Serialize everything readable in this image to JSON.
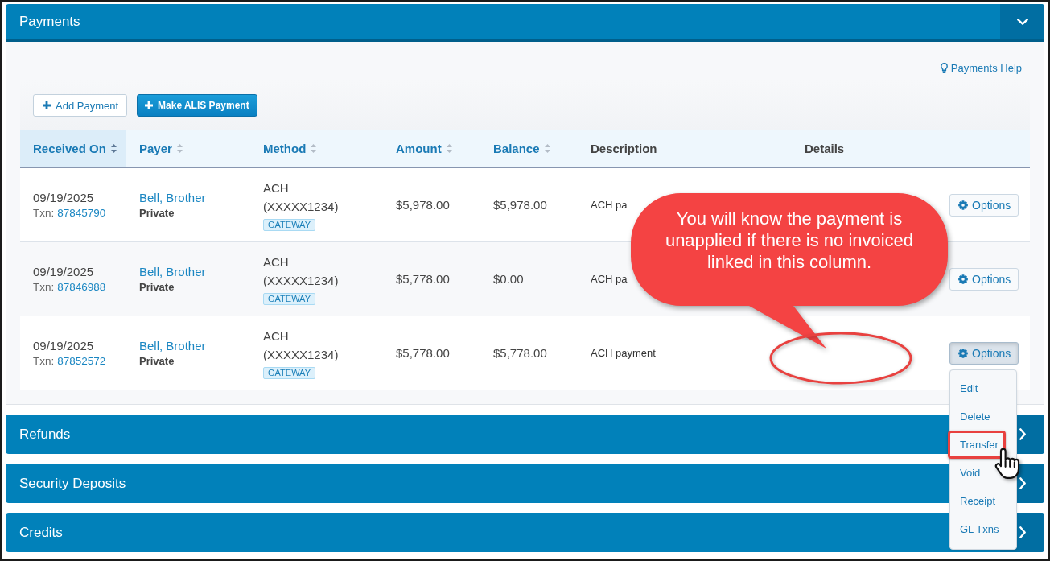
{
  "sections": [
    {
      "title": "Payments",
      "expanded": true,
      "help_link": "Payments Help",
      "toolbar": [
        {
          "label": "Add Payment",
          "kind": "secondary"
        },
        {
          "label": "Make ALIS Payment",
          "kind": "primary"
        }
      ],
      "table": {
        "columns": [
          {
            "label": "Received On",
            "sortable": true,
            "sorted": true
          },
          {
            "label": "Payer",
            "sortable": true,
            "sorted": false
          },
          {
            "label": "Method",
            "sortable": true,
            "sorted": false
          },
          {
            "label": "Amount",
            "sortable": true,
            "sorted": false
          },
          {
            "label": "Balance",
            "sortable": true,
            "sorted": false
          },
          {
            "label": "Description",
            "sortable": false,
            "sorted": false
          },
          {
            "label": "Details",
            "sortable": false,
            "sorted": false
          }
        ],
        "rows": [
          {
            "received_on": "09/19/2025",
            "txn_label": "Txn:",
            "txn": "87845790",
            "payer": "Bell, Brother",
            "payer_type": "Private",
            "method": "ACH",
            "account": "(XXXXX1234)",
            "badge": "GATEWAY",
            "amount": "$5,978.00",
            "balance": "$5,978.00",
            "description": "ACH pa",
            "options": "Options",
            "menu_open": false
          },
          {
            "received_on": "09/19/2025",
            "txn_label": "Txn:",
            "txn": "87846988",
            "payer": "Bell, Brother",
            "payer_type": "Private",
            "method": "ACH",
            "account": "(XXXXX1234)",
            "badge": "GATEWAY",
            "amount": "$5,778.00",
            "balance": "$0.00",
            "description": "ACH pa",
            "options": "Options",
            "menu_open": false
          },
          {
            "received_on": "09/19/2025",
            "txn_label": "Txn:",
            "txn": "87852572",
            "payer": "Bell, Brother",
            "payer_type": "Private",
            "method": "ACH",
            "account": "(XXXXX1234)",
            "badge": "GATEWAY",
            "amount": "$5,778.00",
            "balance": "$5,778.00",
            "description": "ACH payment",
            "options": "Options",
            "menu_open": true
          }
        ],
        "options_menu": [
          {
            "label": "Edit",
            "selected": false
          },
          {
            "label": "Delete",
            "selected": false
          },
          {
            "label": "Transfer",
            "selected": true
          },
          {
            "label": "Void",
            "selected": false
          },
          {
            "label": "Receipt",
            "selected": false
          },
          {
            "label": "GL Txns",
            "selected": false
          }
        ]
      }
    },
    {
      "title": "Refunds",
      "expanded": false
    },
    {
      "title": "Security Deposits",
      "expanded": false
    },
    {
      "title": "Credits",
      "expanded": false
    }
  ],
  "callout": {
    "text": "You will know the payment is unapplied if there is no invoiced linked in this column."
  }
}
